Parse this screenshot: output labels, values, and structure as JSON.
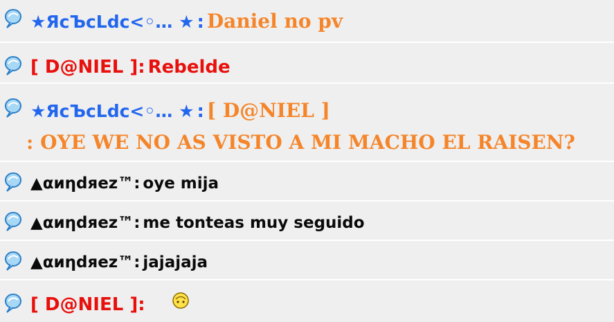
{
  "colors": {
    "background": "#efefef",
    "divider": "#ffffff",
    "blue_nick": "#2366ee",
    "orange_text": "#f5852a",
    "red_text": "#e8100c",
    "black_text": "#0a0a0a"
  },
  "messages": [
    {
      "sender": "★ЯϲЪϲLdϲ<◦… ★",
      "separator": ":",
      "text": "Daniel no pv",
      "icon": "balloon-icon"
    },
    {
      "sender": "[ D@NIEL ]",
      "separator": ":",
      "text": "Rebelde",
      "icon": "balloon-icon"
    },
    {
      "sender": "★ЯϲЪϲLdϲ<◦… ★",
      "separator": ":",
      "text": "[ D@NIEL ]",
      "text_line2": ":  OYE WE NO AS VISTO A MI MACHO EL RAISEN?",
      "icon": "balloon-icon"
    },
    {
      "sender": "▲αиηdяez™",
      "separator": ":",
      "text": "oye mija",
      "icon": "balloon-icon"
    },
    {
      "sender": "▲αиηdяez™",
      "separator": ":",
      "text": "me tonteas muy seguido",
      "icon": "balloon-icon"
    },
    {
      "sender": "▲αиηdяez™",
      "separator": ":",
      "text": "jajajaja",
      "icon": "balloon-icon"
    },
    {
      "sender": "[ D@NIEL ]",
      "separator": ":",
      "text": "",
      "emoticon": "smiley-icon",
      "icon": "balloon-icon"
    }
  ]
}
